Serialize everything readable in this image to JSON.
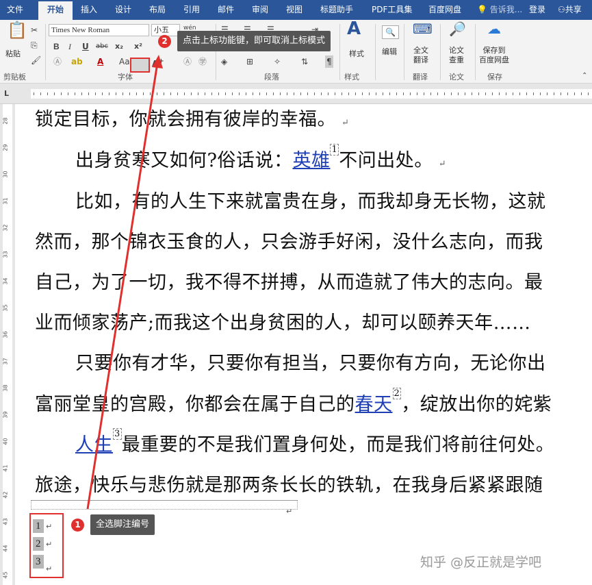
{
  "ribbon_tabs": [
    "文件",
    "开始",
    "插入",
    "设计",
    "布局",
    "引用",
    "邮件",
    "审阅",
    "视图",
    "标题助手",
    "PDF工具集",
    "百度网盘"
  ],
  "active_tab": "开始",
  "tell_me": "告诉我...",
  "login": "登录",
  "share": "共享",
  "font": {
    "name": "Times New Roman",
    "size": "小五",
    "wen": "wén",
    "A_label": "A"
  },
  "toolbar": {
    "paste": "粘贴",
    "bold": "B",
    "italic": "I",
    "underline": "U",
    "strike": "abc",
    "sub": "x₂",
    "sup": "x²",
    "aa": "Aa"
  },
  "groups": {
    "clipboard": "剪贴板",
    "font": "字体",
    "paragraph": "段落",
    "style": "样式",
    "edit": "编辑",
    "translate": "翻译",
    "check": "论文",
    "save": "保存"
  },
  "big_buttons": {
    "style": "样式",
    "edit": "编辑",
    "translate": "全文\n翻译",
    "check": "论文\n查重",
    "save": "保存到\n百度网盘"
  },
  "document_lines": [
    {
      "pre": "锁定目标，你就会拥有彼岸的幸福。",
      "link": "",
      "sup": "",
      "post": ""
    },
    {
      "pre": "出身贫寒又如何?俗话说：",
      "link": "英雄",
      "sup": "1",
      "post": "不问出处。"
    },
    {
      "pre": "比如，有的人生下来就富贵在身，而我却身无长物，这就",
      "link": "",
      "sup": "",
      "post": ""
    },
    {
      "pre": "然而，那个锦衣玉食的人，只会游手好闲，没什么志向，而我",
      "link": "",
      "sup": "",
      "post": ""
    },
    {
      "pre": "自己，为了一切，我不得不拼搏，从而造就了伟大的志向。最",
      "link": "",
      "sup": "",
      "post": ""
    },
    {
      "pre": "业而倾家荡产;而我这个出身贫困的人，却可以颐养天年……",
      "link": "",
      "sup": "",
      "post": ""
    },
    {
      "pre": "只要你有才华，只要你有担当，只要你有方向，无论你出",
      "link": "",
      "sup": "",
      "post": ""
    },
    {
      "pre": "富丽堂皇的宫殿，你都会在属于自己的",
      "link": "春天",
      "sup": "2",
      "post": "，绽放出你的姹紫"
    },
    {
      "pre": "",
      "link": "人生",
      "sup": "3",
      "post": "最重要的不是我们置身何处，而是我们将前往何处。"
    },
    {
      "pre": "旅途，快乐与悲伤就是那两条长长的铁轨，在我身后紧紧跟随",
      "link": "",
      "sup": "",
      "post": ""
    }
  ],
  "footnotes": [
    "1",
    "2",
    "3"
  ],
  "para_mark": "↵",
  "callouts": {
    "one_num": "1",
    "one": "全选脚注编号",
    "two_num": "2",
    "two": "点击上标功能键，即可取消上标模式"
  },
  "vruler_labels": [
    "28",
    "29",
    "30",
    "31",
    "32",
    "33",
    "34",
    "35",
    "36",
    "37",
    "38",
    "39",
    "40",
    "41",
    "42",
    "43",
    "44",
    "45"
  ],
  "watermark": "知乎 @反正就是学吧",
  "colors": {
    "tabbar": "#2b579a",
    "annotation": "#e0302d",
    "link": "#1f3fb5"
  }
}
